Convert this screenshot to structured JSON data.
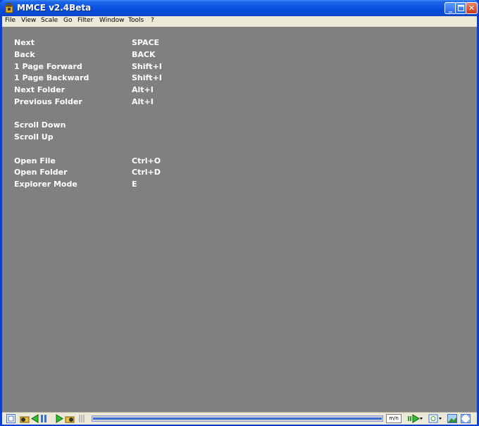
{
  "window": {
    "title": "MMCE v2.4Beta"
  },
  "menu": [
    "File",
    "View",
    "Scale",
    "Go",
    "Filter",
    "Window",
    "Tools",
    "?"
  ],
  "shortcuts": [
    {
      "label": "Next",
      "key": "SPACE"
    },
    {
      "label": "Back",
      "key": "BACK"
    },
    {
      "label": "1 Page Forward",
      "key": "Shift+I"
    },
    {
      "label": "1 Page Backward",
      "key": "Shift+I"
    },
    {
      "label": "Next Folder",
      "key": "Alt+I"
    },
    {
      "label": "Previous Folder",
      "key": "Alt+I"
    },
    {
      "label": "Scroll Down",
      "key": ""
    },
    {
      "label": "Scroll Up",
      "key": ""
    },
    {
      "label": "Open File",
      "key": "Ctrl+O"
    },
    {
      "label": "Open Folder",
      "key": "Ctrl+D"
    },
    {
      "label": "Explorer Mode",
      "key": "E"
    }
  ],
  "statusbar": {
    "ratio": "m/n"
  },
  "colors": {
    "client_bg": "#808080",
    "text": "#ffffff",
    "titlebar": "#0a52e0",
    "menubar": "#ece9d8"
  }
}
